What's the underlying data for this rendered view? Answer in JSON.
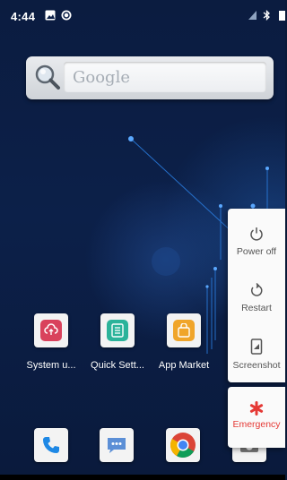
{
  "status_bar": {
    "time": "4:44",
    "left_icons": [
      "image-icon",
      "sync-icon"
    ],
    "right_icons": [
      "signal-icon",
      "bluetooth-icon",
      "battery-icon"
    ]
  },
  "search": {
    "placeholder": "Google",
    "icon": "magnifier-icon"
  },
  "apps": [
    {
      "label": "System u...",
      "icon": "cloud-update-icon",
      "color": "#d9425c"
    },
    {
      "label": "Quick Sett...",
      "icon": "checklist-icon",
      "color": "#2bb39a"
    },
    {
      "label": "App Market",
      "icon": "shopping-bag-icon",
      "color": "#f0a52a"
    }
  ],
  "dock": [
    {
      "icon": "phone-icon",
      "color": "#1e88e5"
    },
    {
      "icon": "messages-icon",
      "color": "#5c8fd6"
    },
    {
      "icon": "chrome-icon",
      "color": "#db4437"
    },
    {
      "icon": "camera-icon",
      "color": "#777777"
    }
  ],
  "power_menu": {
    "items": [
      {
        "label": "Power off",
        "icon": "power-icon"
      },
      {
        "label": "Restart",
        "icon": "restart-icon"
      },
      {
        "label": "Screenshot",
        "icon": "screenshot-icon"
      }
    ],
    "emergency": {
      "label": "Emergency",
      "icon": "asterisk-icon",
      "color": "#e53935"
    }
  }
}
